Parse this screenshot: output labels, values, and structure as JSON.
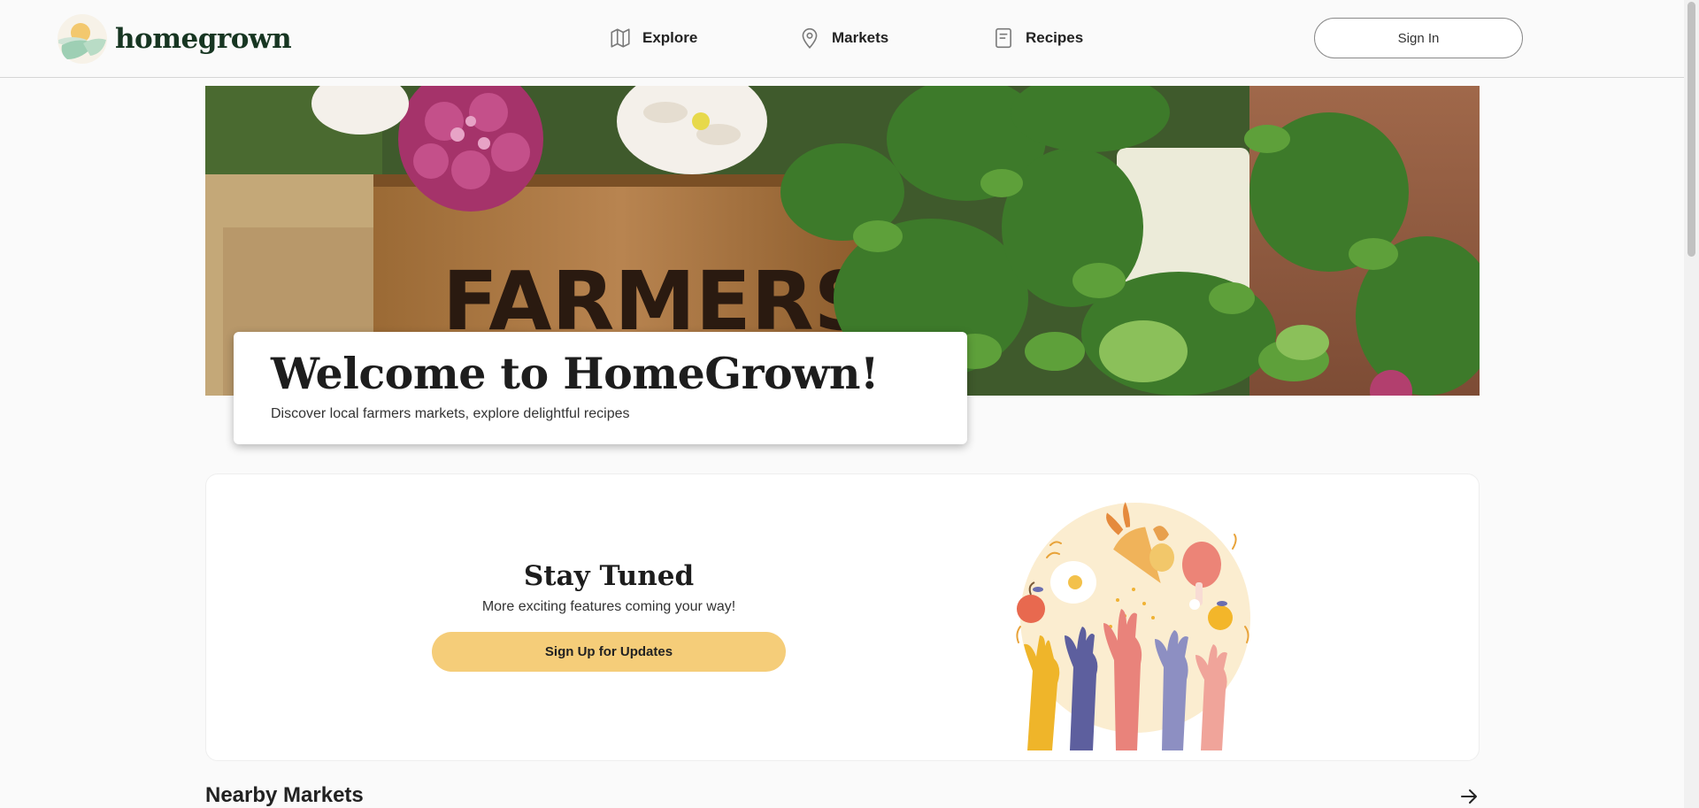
{
  "header": {
    "logo_text": "homegrown",
    "nav": [
      {
        "label": "Explore",
        "icon": "map-icon"
      },
      {
        "label": "Markets",
        "icon": "location-pin-icon"
      },
      {
        "label": "Recipes",
        "icon": "document-icon"
      }
    ],
    "signin_label": "Sign In"
  },
  "hero": {
    "image_sign_text": "FARMERS",
    "title": "Welcome to HomeGrown!",
    "subtitle": "Discover local farmers markets, explore delightful recipes"
  },
  "stay_tuned": {
    "title": "Stay Tuned",
    "subtitle": "More exciting features coming your way!",
    "button_label": "Sign Up for Updates"
  },
  "nearby": {
    "title": "Nearby Markets",
    "arrow_icon": "arrow-right-icon"
  },
  "colors": {
    "brand_dark": "#173622",
    "accent_yellow": "#f5cd79",
    "page_bg": "#fafafa"
  }
}
